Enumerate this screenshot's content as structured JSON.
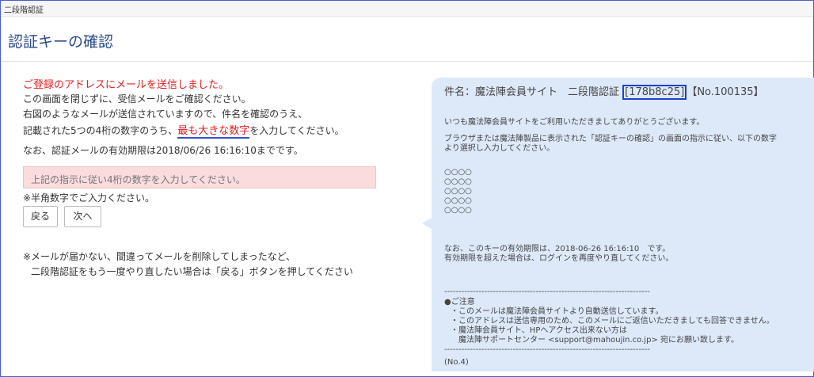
{
  "window": {
    "title": "二段階認証"
  },
  "page": {
    "title": "認証キーの確認"
  },
  "instructions": {
    "sent_notice": "ご登録のアドレスにメールを送信しました。",
    "line1": "この画面を閉じずに、受信メールをご確認ください。",
    "line2": "右図のようなメールが送信されていますので、件名を確認のうえ、",
    "line3_before": "記載された5つの4桁の数字のうち、",
    "line3_highlight": "最も大きな数字",
    "line3_after": "を入力してください。",
    "expiry": "なお、認証メールの有効期限は2018/06/26 16:16:10までです。"
  },
  "form": {
    "code_placeholder": "上記の指示に従い4桁の数字を入力してください。",
    "hint": "※半角数字でご入力ください。",
    "back_label": "戻る",
    "next_label": "次へ"
  },
  "note": {
    "line1": "※メールが届かない、間違ってメールを削除してしまったなど、",
    "line2": "二段階認証をもう一度やり直したい場合は「戻る」ボタンを押してください"
  },
  "email_preview": {
    "subject_prefix": "件名：魔法陣会員サイト　二段階認証 ",
    "subject_code": "[178b8c25]",
    "subject_suffix": "【No.100135】",
    "greeting": "いつも魔法陣会員サイトをご利用いただきましてありがとうございます。",
    "instruction1": "ブラウザまたは魔法陣製品に表示された「認証キーの確認」の画面の指示に従い、以下の数字",
    "instruction2": "より選択し入力してください。",
    "codes": [
      "○○○○",
      "○○○○",
      "○○○○",
      "○○○○",
      "○○○○"
    ],
    "expiry1": "なお、このキーの有効期限は、2018-06-26 16:16:10　です。",
    "expiry2": "有効期限を超えた場合は、ログインを再度やり直してください。",
    "divider": "------------------------------------------------------------------------",
    "caution_title": "●ご注意",
    "caution1": "・このメールは魔法陣会員サイトより自動送信しています。",
    "caution2": "・このアドレスは送信専用のため、このメールにご返信いただきましても回答できません。",
    "caution3": "・魔法陣会員サイト、HPへアクセス出来ない方は",
    "caution4": "　魔法陣サポートセンター <support@mahoujin.co.jp> 宛にお願い致します。",
    "footer": "(No.4)"
  }
}
